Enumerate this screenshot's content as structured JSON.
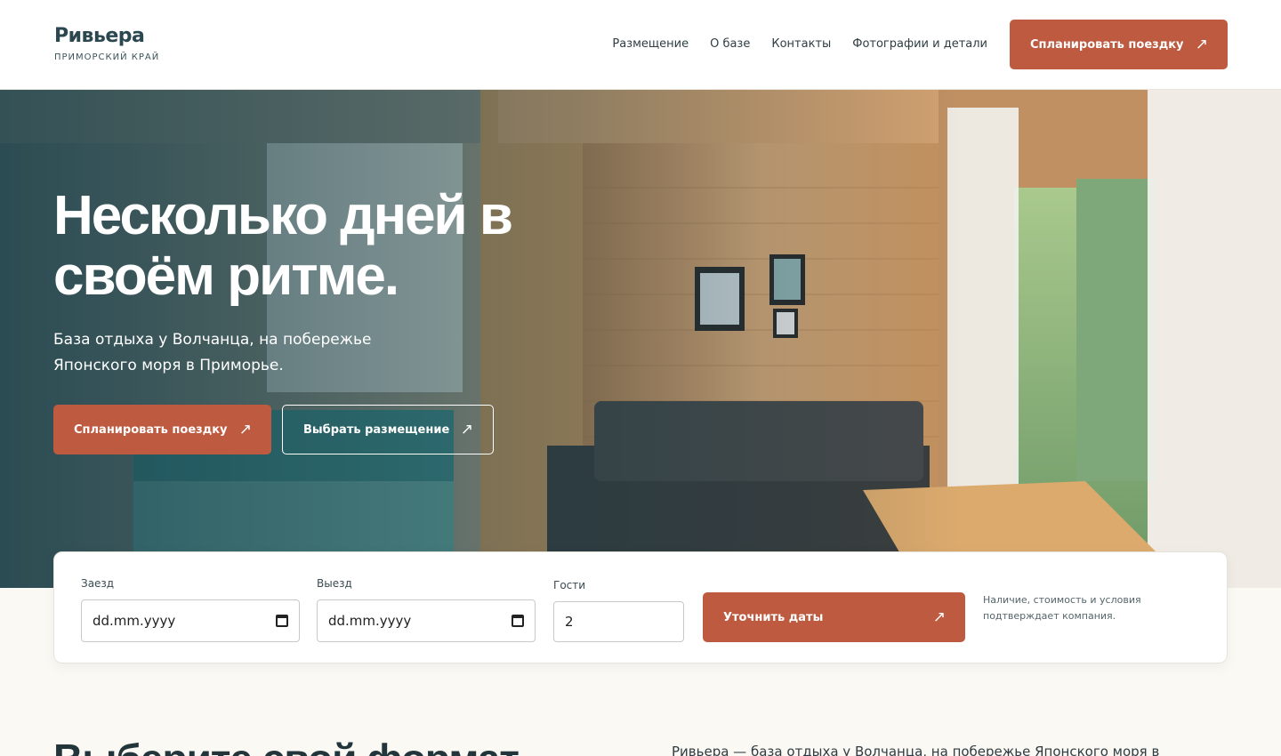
{
  "header": {
    "logo_name": "Ривьера",
    "logo_sub": "ПРИМОРСКИЙ КРАЙ",
    "nav": [
      "Размещение",
      "О базе",
      "Контакты",
      "Фотографии и детали"
    ],
    "cta_label": "Спланировать поездку",
    "cta_icon": "↗"
  },
  "hero": {
    "title": "Несколько дней в своём ритме.",
    "subtitle": "База отдыха у Волчанца, на побережье Японского моря в Приморье.",
    "primary_button": "Спланировать поездку",
    "secondary_button": "Выбрать размещение",
    "arrow": "↗"
  },
  "booking": {
    "checkin_label": "Заезд",
    "checkin_placeholder": "dd.mm.yyyy",
    "checkout_label": "Выезд",
    "checkout_placeholder": "dd.mm.yyyy",
    "guests_label": "Гости",
    "guests_value": "2",
    "submit_label": "Уточнить даты",
    "note": "Наличие, стоимость и условия подтверждает компания."
  },
  "section": {
    "title": "Выберите свой формат",
    "intro": "Ривьера — база отдыха у Волчанца, на побережье Японского моря в"
  },
  "colors": {
    "accent": "#bd5a40",
    "brand_dark": "#2b4750",
    "page_bg": "#fbf9f4"
  }
}
